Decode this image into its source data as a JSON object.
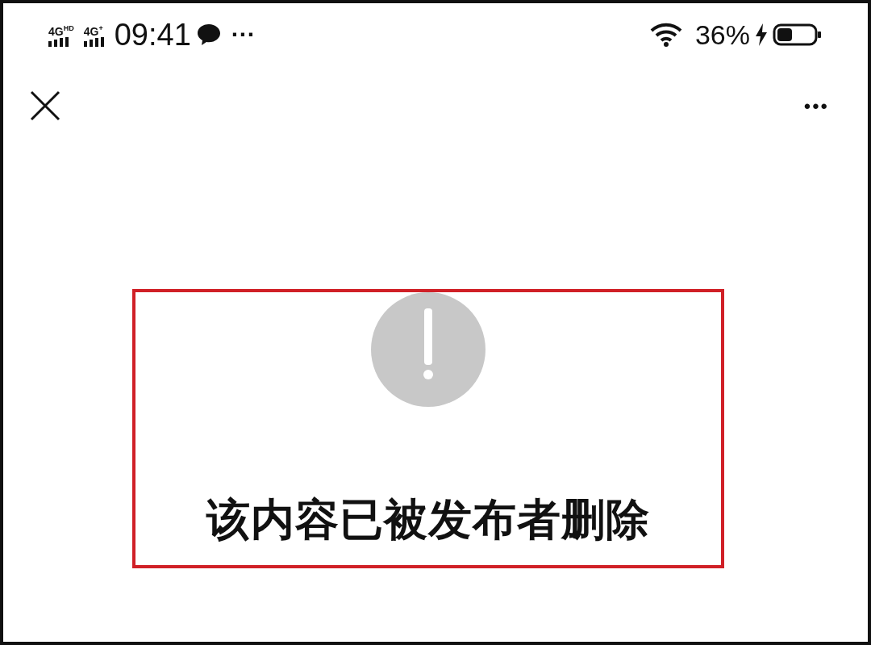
{
  "status_bar": {
    "networks": [
      "4G$^{HD}$",
      "4G$^{+}$"
    ],
    "time": "09:41",
    "more": "···",
    "battery_percent": "36%",
    "charging": true
  },
  "nav": {
    "more": "•••"
  },
  "notice": {
    "message": "该内容已被发布者删除",
    "highlighted": true
  }
}
